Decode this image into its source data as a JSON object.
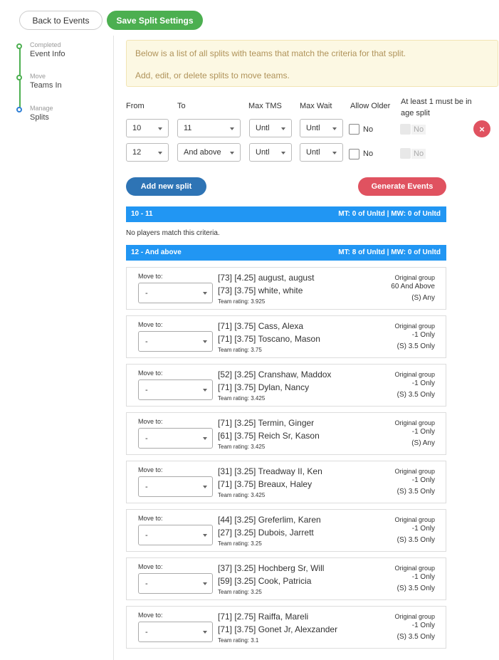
{
  "toolbar": {
    "back_label": "Back to Events",
    "save_label": "Save Split Settings"
  },
  "steps": [
    {
      "status": "Completed",
      "label": "Event Info"
    },
    {
      "status": "Move",
      "label": "Teams In"
    },
    {
      "status": "Manage",
      "label": "Splits"
    }
  ],
  "notice": {
    "line1": "Below is a list of all splits with teams that match the criteria for that split.",
    "line2": "Add, edit, or delete splits to move teams."
  },
  "split_headers": {
    "from": "From",
    "to": "To",
    "max_tms": "Max TMS",
    "max_wait": "Max Wait",
    "allow_older": "Allow Older",
    "age_split": "At least 1 must be in age split"
  },
  "split_rows": [
    {
      "from": "10",
      "to": "11",
      "max_tms": "Untl",
      "max_wait": "Untl",
      "allow_older": "No",
      "age_split": "No"
    },
    {
      "from": "12",
      "to": "And above",
      "max_tms": "Untl",
      "max_wait": "Untl",
      "allow_older": "No",
      "age_split": "No"
    }
  ],
  "actions": {
    "add_label": "Add new split",
    "generate_label": "Generate Events",
    "delete_icon": "×"
  },
  "groups": [
    {
      "label": "10 - 11",
      "summary": "MT: 0 of Unltd | MW: 0 of Unltd",
      "empty_text": "No players match this criteria."
    },
    {
      "label": "12 - And above",
      "summary": "MT: 8 of Unltd | MW: 0 of Unltd"
    }
  ],
  "cards": [
    {
      "move_to": "Move to:",
      "select_value": "-",
      "p1": "[73] [4.25] august, august",
      "p2": "[73] [3.75] white, white",
      "rating": "Team rating: 3.925",
      "og": "Original group",
      "g1": "60 And Above",
      "g2": "(S) Any"
    },
    {
      "move_to": "Move to:",
      "select_value": "-",
      "p1": "[71] [3.75] Cass, Alexa",
      "p2": "[71] [3.75] Toscano, Mason",
      "rating": "Team rating: 3.75",
      "og": "Original group",
      "g1": "-1 Only",
      "g2": "(S) 3.5 Only"
    },
    {
      "move_to": "Move to:",
      "select_value": "-",
      "p1": "[52] [3.25] Cranshaw, Maddox",
      "p2": "[71] [3.75] Dylan, Nancy",
      "rating": "Team rating: 3.425",
      "og": "Original group",
      "g1": "-1 Only",
      "g2": "(S) 3.5 Only"
    },
    {
      "move_to": "Move to:",
      "select_value": "-",
      "p1": "[71] [3.25] Termin, Ginger",
      "p2": "[61] [3.75] Reich Sr, Kason",
      "rating": "Team rating: 3.425",
      "og": "Original group",
      "g1": "-1 Only",
      "g2": "(S) Any"
    },
    {
      "move_to": "Move to:",
      "select_value": "-",
      "p1": "[31] [3.25] Treadway II, Ken",
      "p2": "[71] [3.75] Breaux, Haley",
      "rating": "Team rating: 3.425",
      "og": "Original group",
      "g1": "-1 Only",
      "g2": "(S) 3.5 Only"
    },
    {
      "move_to": "Move to:",
      "select_value": "-",
      "p1": "[44] [3.25] Greferlim, Karen",
      "p2": "[27] [3.25] Dubois, Jarrett",
      "rating": "Team rating: 3.25",
      "og": "Original group",
      "g1": "-1 Only",
      "g2": "(S) 3.5 Only"
    },
    {
      "move_to": "Move to:",
      "select_value": "-",
      "p1": "[37] [3.25] Hochberg Sr, Will",
      "p2": "[59] [3.25] Cook, Patricia",
      "rating": "Team rating: 3.25",
      "og": "Original group",
      "g1": "-1 Only",
      "g2": "(S) 3.5 Only"
    },
    {
      "move_to": "Move to:",
      "select_value": "-",
      "p1": "[71] [2.75] Raiffa, Mareli",
      "p2": "[71] [3.75] Gonet Jr, Alexzander",
      "rating": "Team rating: 3.1",
      "og": "Original group",
      "g1": "-1 Only",
      "g2": "(S) 3.5 Only"
    }
  ]
}
